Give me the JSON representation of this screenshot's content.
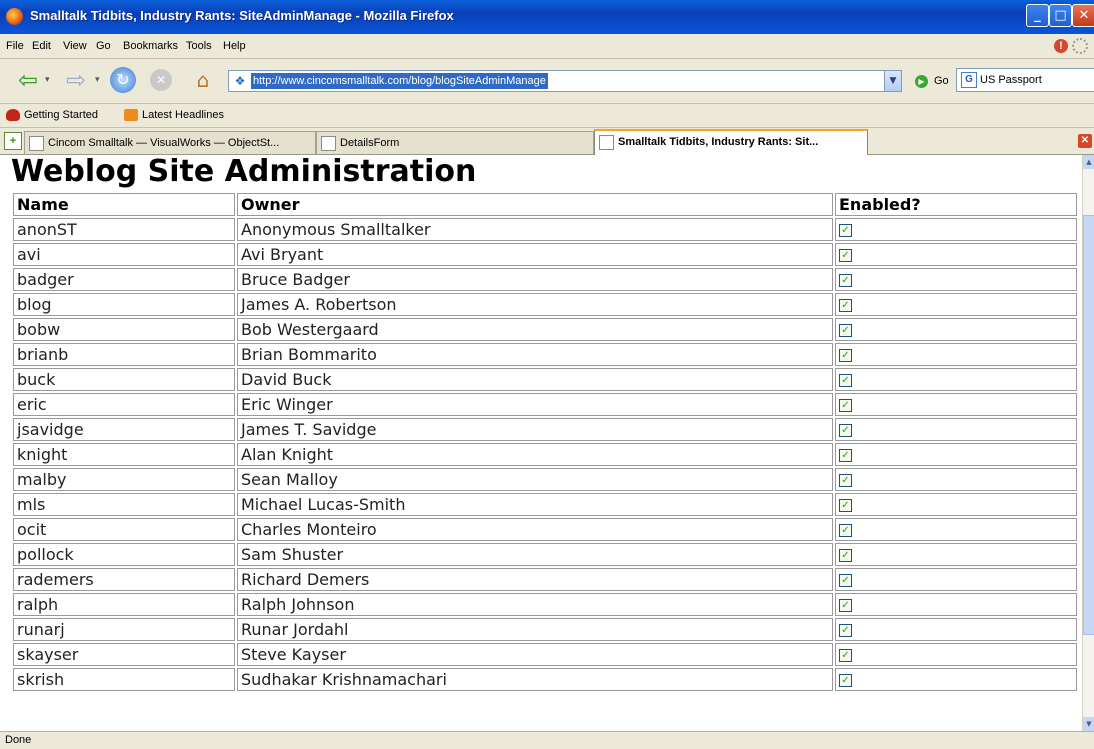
{
  "window": {
    "title": "Smalltalk Tidbits, Industry Rants: SiteAdminManage - Mozilla Firefox",
    "min_glyph": "_",
    "max_glyph": "□",
    "close_glyph": "✕"
  },
  "menu": [
    "File",
    "Edit",
    "View",
    "Go",
    "Bookmarks",
    "Tools",
    "Help"
  ],
  "navigation": {
    "url": "http://www.cincomsmalltalk.com/blog/blogSiteAdminManage",
    "go_label": "Go",
    "search_value": "US Passport"
  },
  "bookmarks": [
    "Getting Started",
    "Latest Headlines"
  ],
  "tabs": [
    {
      "label": "Cincom Smalltalk — VisualWorks — ObjectSt...",
      "active": false
    },
    {
      "label": "DetailsForm",
      "active": false
    },
    {
      "label": "Smalltalk Tidbits, Industry Rants: Sit...",
      "active": true
    }
  ],
  "page": {
    "title": "Weblog Site Administration",
    "columns": [
      "Name",
      "Owner",
      "Enabled?"
    ],
    "rows": [
      {
        "name": "anonST",
        "owner": "Anonymous Smalltalker",
        "enabled": true
      },
      {
        "name": "avi",
        "owner": "Avi Bryant",
        "enabled": true
      },
      {
        "name": "badger",
        "owner": "Bruce Badger",
        "enabled": true
      },
      {
        "name": "blog",
        "owner": "James A. Robertson",
        "enabled": true
      },
      {
        "name": "bobw",
        "owner": "Bob Westergaard",
        "enabled": true
      },
      {
        "name": "brianb",
        "owner": "Brian Bommarito",
        "enabled": true
      },
      {
        "name": "buck",
        "owner": "David Buck",
        "enabled": true
      },
      {
        "name": "eric",
        "owner": "Eric Winger",
        "enabled": true
      },
      {
        "name": "jsavidge",
        "owner": "James T. Savidge",
        "enabled": true
      },
      {
        "name": "knight",
        "owner": "Alan Knight",
        "enabled": true
      },
      {
        "name": "malby",
        "owner": "Sean Malloy",
        "enabled": true
      },
      {
        "name": "mls",
        "owner": "Michael Lucas-Smith",
        "enabled": true
      },
      {
        "name": "ocit",
        "owner": "Charles Monteiro",
        "enabled": true
      },
      {
        "name": "pollock",
        "owner": "Sam Shuster",
        "enabled": true
      },
      {
        "name": "rademers",
        "owner": "Richard Demers",
        "enabled": true
      },
      {
        "name": "ralph",
        "owner": "Ralph Johnson",
        "enabled": true
      },
      {
        "name": "runarj",
        "owner": "Runar Jordahl",
        "enabled": true
      },
      {
        "name": "skayser",
        "owner": "Steve Kayser",
        "enabled": true
      },
      {
        "name": "skrish",
        "owner": "Sudhakar Krishnamachari",
        "enabled": true
      }
    ]
  },
  "status": "Done",
  "icons": {
    "checkbox_checked": "✓",
    "nav_back": "⇦",
    "nav_forward": "⇨",
    "reload": "↻",
    "stop": "✕",
    "home": "⌂"
  },
  "colors": {
    "titlebar": "#0a56d6",
    "url_highlight": "#316ac5",
    "checkmark": "#21a121",
    "active_tab_accent": "#f3a42a"
  }
}
